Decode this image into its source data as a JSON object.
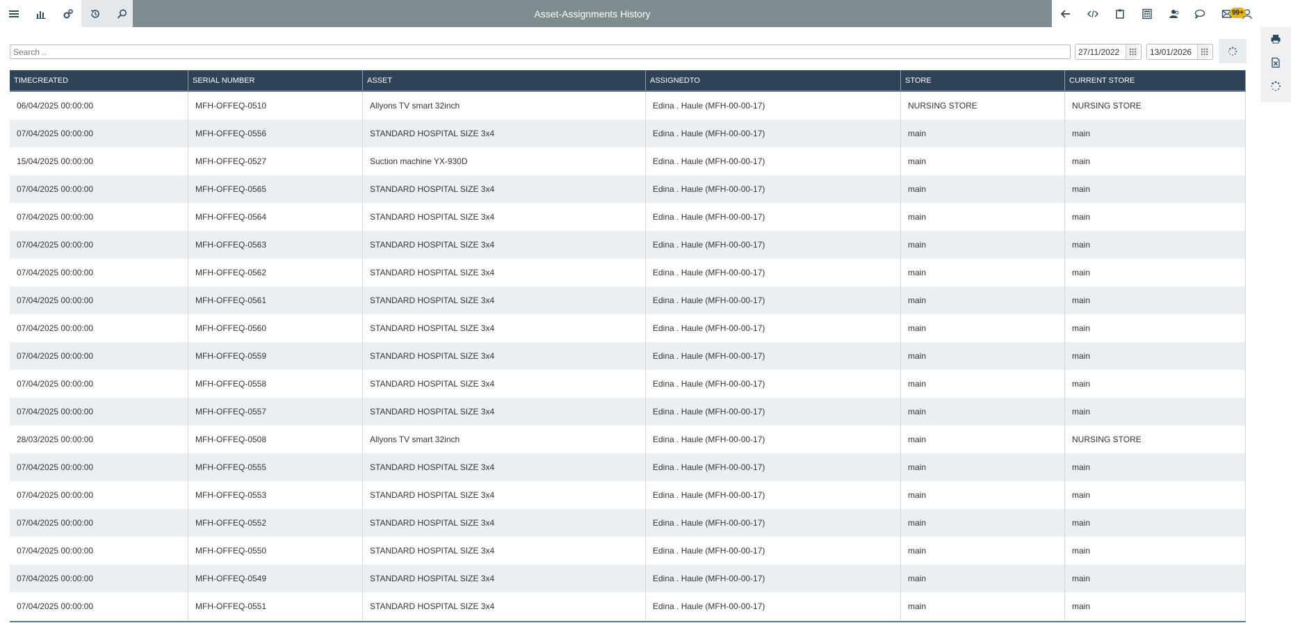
{
  "header": {
    "title": "Asset-Assignments History",
    "left_icons": [
      "menu-icon",
      "bar-chart-icon",
      "settings-gears-icon",
      "history-icon",
      "search-icon"
    ],
    "right_icons": [
      "back-arrow-icon",
      "code-icon",
      "clipboard-icon",
      "calculator-icon",
      "users-icon"
    ],
    "far_right_icons": [
      "chat-icon",
      "mail-icon",
      "user-icon"
    ],
    "notification_badge": "99+"
  },
  "side_tools": [
    "print-icon",
    "excel-export-icon",
    "loading-spinner-icon"
  ],
  "search": {
    "placeholder": "Search ..",
    "value": ""
  },
  "filters": {
    "date_from": "27/11/2022",
    "date_to": "13/01/2026"
  },
  "table": {
    "columns": [
      "TIMECREATED",
      "SERIAL NUMBER",
      "ASSET",
      "ASSIGNEDTO",
      "STORE",
      "CURRENT STORE"
    ],
    "rows": [
      [
        "06/04/2025 00:00:00",
        "MFH-OFFEQ-0510",
        "Allyons TV smart 32inch",
        "Edina . Haule (MFH-00-00-17)",
        "NURSING STORE",
        "NURSING STORE"
      ],
      [
        "07/04/2025 00:00:00",
        "MFH-OFFEQ-0556",
        "STANDARD HOSPITAL SIZE 3x4",
        "Edina . Haule (MFH-00-00-17)",
        "main",
        "main"
      ],
      [
        "15/04/2025 00:00:00",
        "MFH-OFFEQ-0527",
        "Suction machine YX-930D",
        "Edina . Haule (MFH-00-00-17)",
        "main",
        "main"
      ],
      [
        "07/04/2025 00:00:00",
        "MFH-OFFEQ-0565",
        "STANDARD HOSPITAL SIZE 3x4",
        "Edina . Haule (MFH-00-00-17)",
        "main",
        "main"
      ],
      [
        "07/04/2025 00:00:00",
        "MFH-OFFEQ-0564",
        "STANDARD HOSPITAL SIZE 3x4",
        "Edina . Haule (MFH-00-00-17)",
        "main",
        "main"
      ],
      [
        "07/04/2025 00:00:00",
        "MFH-OFFEQ-0563",
        "STANDARD HOSPITAL SIZE 3x4",
        "Edina . Haule (MFH-00-00-17)",
        "main",
        "main"
      ],
      [
        "07/04/2025 00:00:00",
        "MFH-OFFEQ-0562",
        "STANDARD HOSPITAL SIZE 3x4",
        "Edina . Haule (MFH-00-00-17)",
        "main",
        "main"
      ],
      [
        "07/04/2025 00:00:00",
        "MFH-OFFEQ-0561",
        "STANDARD HOSPITAL SIZE 3x4",
        "Edina . Haule (MFH-00-00-17)",
        "main",
        "main"
      ],
      [
        "07/04/2025 00:00:00",
        "MFH-OFFEQ-0560",
        "STANDARD HOSPITAL SIZE 3x4",
        "Edina . Haule (MFH-00-00-17)",
        "main",
        "main"
      ],
      [
        "07/04/2025 00:00:00",
        "MFH-OFFEQ-0559",
        "STANDARD HOSPITAL SIZE 3x4",
        "Edina . Haule (MFH-00-00-17)",
        "main",
        "main"
      ],
      [
        "07/04/2025 00:00:00",
        "MFH-OFFEQ-0558",
        "STANDARD HOSPITAL SIZE 3x4",
        "Edina . Haule (MFH-00-00-17)",
        "main",
        "main"
      ],
      [
        "07/04/2025 00:00:00",
        "MFH-OFFEQ-0557",
        "STANDARD HOSPITAL SIZE 3x4",
        "Edina . Haule (MFH-00-00-17)",
        "main",
        "main"
      ],
      [
        "28/03/2025 00:00:00",
        "MFH-OFFEQ-0508",
        "Allyons TV smart 32inch",
        "Edina . Haule (MFH-00-00-17)",
        "main",
        "NURSING STORE"
      ],
      [
        "07/04/2025 00:00:00",
        "MFH-OFFEQ-0555",
        "STANDARD HOSPITAL SIZE 3x4",
        "Edina . Haule (MFH-00-00-17)",
        "main",
        "main"
      ],
      [
        "07/04/2025 00:00:00",
        "MFH-OFFEQ-0553",
        "STANDARD HOSPITAL SIZE 3x4",
        "Edina . Haule (MFH-00-00-17)",
        "main",
        "main"
      ],
      [
        "07/04/2025 00:00:00",
        "MFH-OFFEQ-0552",
        "STANDARD HOSPITAL SIZE 3x4",
        "Edina . Haule (MFH-00-00-17)",
        "main",
        "main"
      ],
      [
        "07/04/2025 00:00:00",
        "MFH-OFFEQ-0550",
        "STANDARD HOSPITAL SIZE 3x4",
        "Edina . Haule (MFH-00-00-17)",
        "main",
        "main"
      ],
      [
        "07/04/2025 00:00:00",
        "MFH-OFFEQ-0549",
        "STANDARD HOSPITAL SIZE 3x4",
        "Edina . Haule (MFH-00-00-17)",
        "main",
        "main"
      ],
      [
        "07/04/2025 00:00:00",
        "MFH-OFFEQ-0551",
        "STANDARD HOSPITAL SIZE 3x4",
        "Edina . Haule (MFH-00-00-17)",
        "main",
        "main"
      ]
    ]
  }
}
